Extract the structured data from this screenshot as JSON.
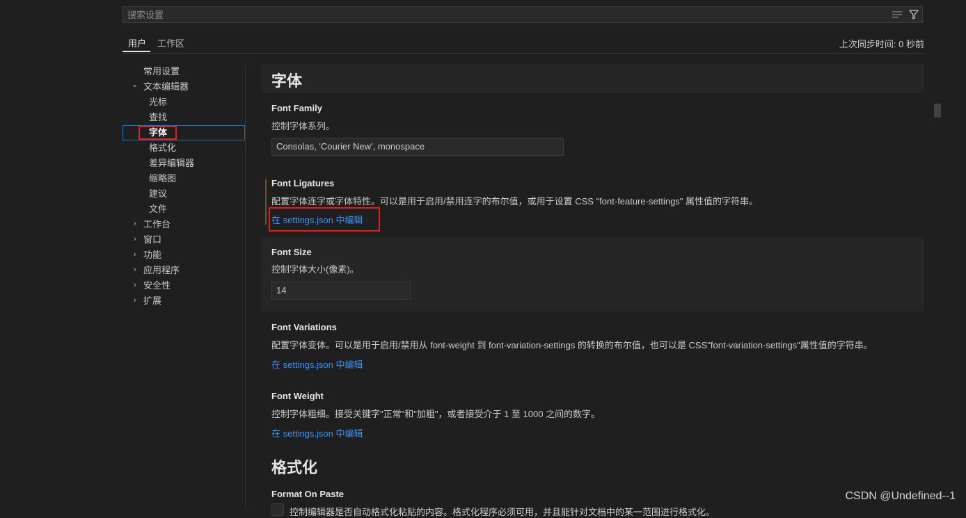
{
  "search": {
    "placeholder": "搜索设置",
    "value": ""
  },
  "tabs": [
    {
      "label": "用户"
    },
    {
      "label": "工作区"
    }
  ],
  "sync_status": "上次同步时间: 0 秒前",
  "toc": {
    "common": "常用设置",
    "text_editor": "文本编辑器",
    "cursor": "光标",
    "find": "查找",
    "font": "字体",
    "formatting": "格式化",
    "diff_editor": "差异编辑器",
    "minimap": "缩略图",
    "suggestions": "建议",
    "files": "文件",
    "workbench": "工作台",
    "window": "窗口",
    "features": "功能",
    "application": "应用程序",
    "security": "安全性",
    "extensions": "扩展"
  },
  "sections": {
    "font": {
      "title": "字体",
      "font_family": {
        "title": "Font Family",
        "description": "控制字体系列。",
        "value": "Consolas, 'Courier New', monospace"
      },
      "font_ligatures": {
        "title": "Font Ligatures",
        "description": "配置字体连字或字体特性。可以是用于启用/禁用连字的布尔值，或用于设置 CSS \"font-feature-settings\" 属性值的字符串。",
        "link": "在 settings.json 中编辑"
      },
      "font_size": {
        "title": "Font Size",
        "description": "控制字体大小(像素)。",
        "value": "14"
      },
      "font_variations": {
        "title": "Font Variations",
        "description": "配置字体变体。可以是用于启用/禁用从 font-weight 到 font-variation-settings 的转换的布尔值，也可以是 CSS\"font-variation-settings\"属性值的字符串。",
        "link": "在 settings.json 中编辑"
      },
      "font_weight": {
        "title": "Font Weight",
        "description": "控制字体粗细。接受关键字\"正常\"和\"加粗\"，或者接受介于 1 至 1000 之间的数字。",
        "link": "在 settings.json 中编辑"
      }
    },
    "formatting": {
      "title": "格式化",
      "format_on_paste": {
        "title": "Format On Paste",
        "description": "控制编辑器是否自动格式化粘贴的内容。格式化程序必须可用，并且能针对文档中的某一范围进行格式化。"
      }
    }
  },
  "watermark": "CSDN @Undefined--1",
  "colors": {
    "accent": "#3794ff",
    "highlight": "#e02020",
    "focus_border": "#1f6fc5"
  }
}
